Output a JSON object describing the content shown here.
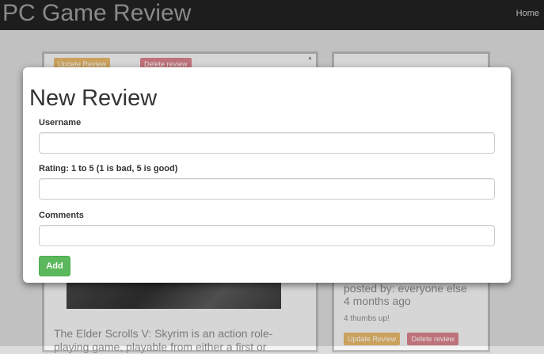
{
  "navbar": {
    "brand": "PC Game Review",
    "home": "Home"
  },
  "background": {
    "left_card": {
      "update_label": "Update Review",
      "delete_label": "Delete review",
      "description": "The Elder Scrolls V: Skyrim is an action role-playing game, playable from either a first or"
    },
    "right_card": {
      "posted_by": "posted by: everyone else",
      "time_ago": "4 months ago",
      "thumbs": "4 thumbs up!",
      "update_label": "Update Review",
      "delete_label": "Delete review"
    }
  },
  "modal": {
    "title": "New Review",
    "fields": [
      {
        "label": "Username",
        "value": ""
      },
      {
        "label": "Rating: 1 to 5 (1 is bad, 5 is good)",
        "value": ""
      },
      {
        "label": "Comments",
        "value": ""
      }
    ],
    "add_label": "Add"
  },
  "colors": {
    "navbar": "#222222",
    "add_button": "#5cb85c",
    "warning": "#e6b86a",
    "danger": "#d9828a"
  }
}
